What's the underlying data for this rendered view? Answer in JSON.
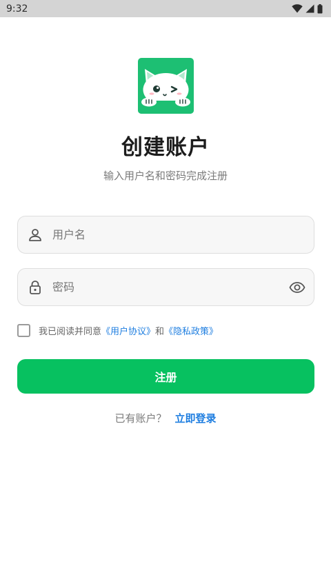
{
  "status_bar": {
    "time": "9:32",
    "icons": [
      "wifi-icon",
      "cellular-signal-icon",
      "battery-icon"
    ]
  },
  "logo": {
    "icon": "cat-mascot-icon",
    "background": "#1dbf73"
  },
  "header": {
    "title": "创建账户",
    "subtitle": "输入用户名和密码完成注册"
  },
  "form": {
    "username": {
      "placeholder": "用户名",
      "value": "",
      "icon": "user-icon"
    },
    "password": {
      "placeholder": "密码",
      "value": "",
      "icon": "lock-icon",
      "toggle_icon": "eye-icon"
    }
  },
  "agreement": {
    "checked": false,
    "prefix": "我已阅读并同意",
    "user_agreement": "《用户协议》",
    "conjunction": "和",
    "privacy_policy": "《隐私政策》"
  },
  "register_button": {
    "label": "注册",
    "color": "#07c160"
  },
  "login": {
    "prompt": "已有账户？",
    "link": "立即登录"
  },
  "colors": {
    "accent": "#07c160",
    "link": "#1e7ee0"
  }
}
